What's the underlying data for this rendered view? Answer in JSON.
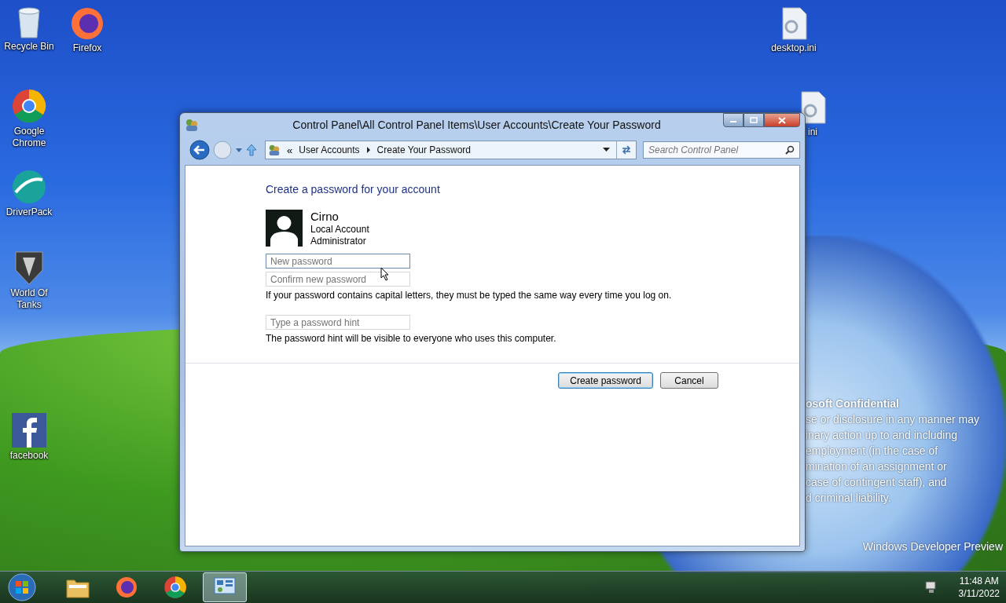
{
  "desktop": {
    "icons": [
      {
        "label": "Recycle Bin",
        "kind": "bin"
      },
      {
        "label": "Firefox",
        "kind": "firefox"
      },
      {
        "label": "Google Chrome",
        "kind": "chrome"
      },
      {
        "label": "DriverPack",
        "kind": "driverpack"
      },
      {
        "label": "World Of Tanks",
        "kind": "tanks"
      },
      {
        "label": "facebook",
        "kind": "facebook"
      },
      {
        "label": "desktop.ini",
        "kind": "file"
      },
      {
        "label": "ini",
        "kind": "file"
      }
    ],
    "confidential_notice": [
      "osoft Confidential",
      "se or disclosure in any manner may",
      "inary action up to and including",
      "employment (in the case of",
      "mination of an assignment or",
      "case of contingent staff), and",
      "d criminal liability."
    ],
    "build_notice": "Windows Developer Preview"
  },
  "window": {
    "title": "Control Panel\\All Control Panel Items\\User Accounts\\Create Your Password",
    "address_bar": {
      "prefix": "«",
      "crumbs": [
        "User Accounts",
        "Create Your Password"
      ]
    },
    "search": {
      "placeholder": "Search Control Panel"
    },
    "heading": "Create a password for your account",
    "account": {
      "name": "Cirno",
      "type": "Local Account",
      "role": "Administrator"
    },
    "fields": [
      {
        "placeholder": "New password",
        "focused": true
      },
      {
        "placeholder": "Confirm new password",
        "focused": false
      }
    ],
    "caps_note": "If your password contains capital letters, they must be typed the same way every time you log on.",
    "hint_field": {
      "placeholder": "Type a password hint"
    },
    "hint_note": "The password hint will be visible to everyone who uses this computer.",
    "buttons": [
      {
        "label": "Create password",
        "default": true
      },
      {
        "label": "Cancel",
        "default": false
      }
    ]
  },
  "taskbar": {
    "apps": [
      {
        "kind": "explorer",
        "selected": false
      },
      {
        "kind": "firefox",
        "selected": false
      },
      {
        "kind": "chrome",
        "selected": false
      },
      {
        "kind": "controlpanel",
        "selected": true
      }
    ],
    "clock": {
      "time": "11:48 AM",
      "date": "3/11/2022"
    }
  }
}
